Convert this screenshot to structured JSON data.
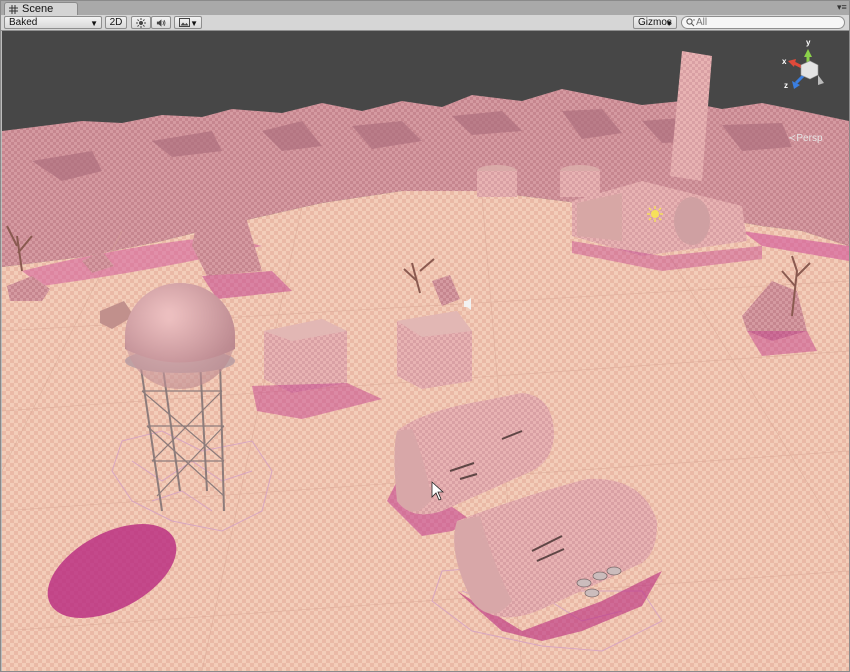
{
  "tab": {
    "title": "Scene"
  },
  "toolbar": {
    "draw_mode": "Baked",
    "mode_2d": "2D",
    "gizmos": "Gizmos",
    "search_placeholder": "All"
  },
  "gizmo": {
    "projection": "Persp",
    "axis_x": "x",
    "axis_y": "y",
    "axis_z": "z"
  },
  "colors": {
    "sky": "#474747",
    "ground": "#f1c8b5",
    "cliff": "#c98c99",
    "shadow": "#b8287f",
    "building": "#c89c98"
  }
}
